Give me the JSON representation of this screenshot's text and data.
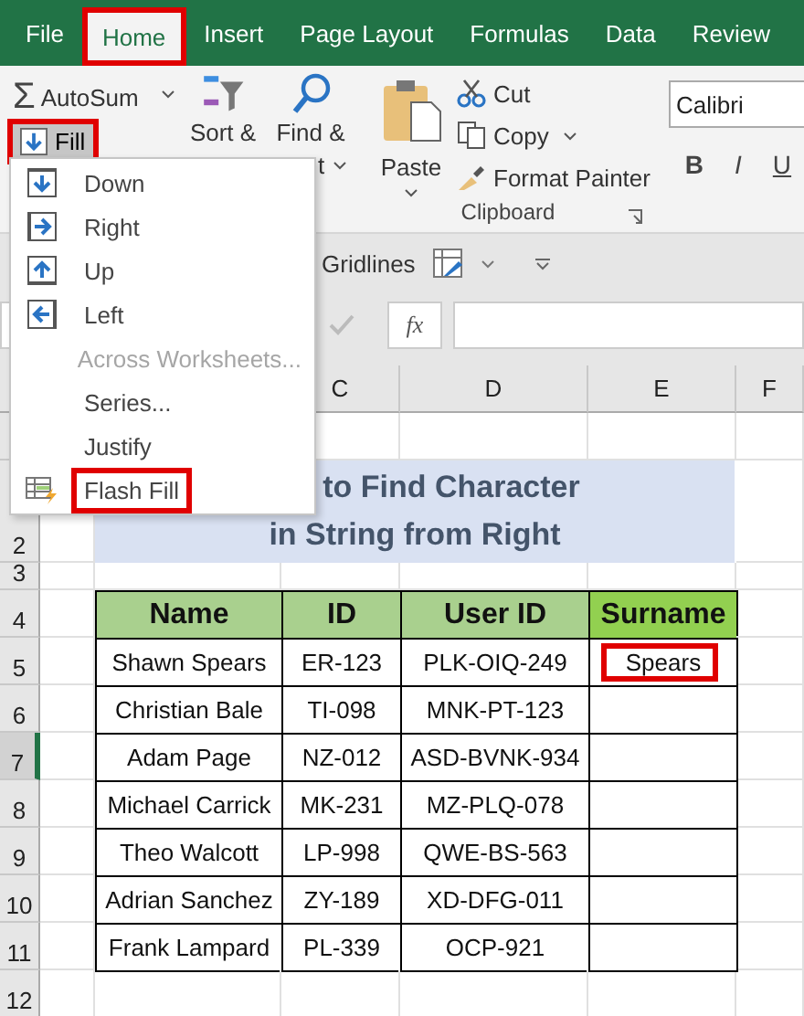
{
  "ribbon_tabs": [
    {
      "label": "File",
      "selected": false,
      "highlighted": false
    },
    {
      "label": "Home",
      "selected": true,
      "highlighted": true
    },
    {
      "label": "Insert",
      "selected": false,
      "highlighted": false
    },
    {
      "label": "Page Layout",
      "selected": false,
      "highlighted": false
    },
    {
      "label": "Formulas",
      "selected": false,
      "highlighted": false
    },
    {
      "label": "Data",
      "selected": false,
      "highlighted": false
    },
    {
      "label": "Review",
      "selected": false,
      "highlighted": false
    }
  ],
  "editing": {
    "autosum_symbol": "Σ",
    "autosum": "AutoSum",
    "fill": {
      "label": "Fill",
      "highlighted": true
    },
    "sort_label": "Sort &",
    "find_label": "Find &",
    "find_label_line2": "t"
  },
  "clipboard": {
    "paste": "Paste",
    "cut": "Cut",
    "copy": "Copy",
    "format_painter": "Format Painter",
    "group_label": "Clipboard"
  },
  "font": {
    "font_name": "Calibri",
    "bold": "B",
    "italic": "I",
    "underline": "U"
  },
  "view_bar": {
    "gridlines": "Gridlines"
  },
  "formula_bar": {
    "fx": "fx"
  },
  "fill_menu": [
    {
      "label": "Down",
      "kind": "down",
      "disabled": false,
      "highlighted": false
    },
    {
      "label": "Right",
      "kind": "right",
      "disabled": false,
      "highlighted": false
    },
    {
      "label": "Up",
      "kind": "up",
      "disabled": false,
      "highlighted": false
    },
    {
      "label": "Left",
      "kind": "left",
      "disabled": false,
      "highlighted": false
    },
    {
      "label": "Across Worksheets...",
      "kind": "plain",
      "disabled": true,
      "highlighted": false
    },
    {
      "label": "Series...",
      "kind": "plain",
      "disabled": false,
      "highlighted": false
    },
    {
      "label": "Justify",
      "kind": "plain",
      "disabled": false,
      "highlighted": false
    },
    {
      "label": "Flash Fill",
      "kind": "flash",
      "disabled": false,
      "highlighted": true
    }
  ],
  "columns": [
    "C",
    "D",
    "E",
    "F"
  ],
  "row_headers": [
    {
      "label": "2",
      "selected": false
    },
    {
      "label": "3",
      "selected": false
    },
    {
      "label": "4",
      "selected": false
    },
    {
      "label": "5",
      "selected": false
    },
    {
      "label": "6",
      "selected": false
    },
    {
      "label": "7",
      "selected": true
    },
    {
      "label": "8",
      "selected": false
    },
    {
      "label": "9",
      "selected": false
    },
    {
      "label": "10",
      "selected": false
    },
    {
      "label": "11",
      "selected": false
    },
    {
      "label": "12",
      "selected": false
    }
  ],
  "title": [
    "to Find Character",
    "in String from Right"
  ],
  "table": {
    "headers": [
      {
        "label": "Name",
        "color": "#a9d08e"
      },
      {
        "label": "ID",
        "color": "#a9d08e"
      },
      {
        "label": "User ID",
        "color": "#a9d08e"
      },
      {
        "label": "Surname",
        "color": "#92d050"
      }
    ],
    "rows": [
      {
        "name": "Shawn Spears",
        "id": "ER-123",
        "user_id": "PLK-OIQ-249",
        "surname": "Spears",
        "highlighted": true
      },
      {
        "name": "Christian Bale",
        "id": "TI-098",
        "user_id": "MNK-PT-123",
        "highlighted": false
      },
      {
        "name": "Adam Page",
        "id": "NZ-012",
        "user_id": "ASD-BVNK-934",
        "highlighted": false
      },
      {
        "name": "Michael Carrick",
        "id": "MK-231",
        "user_id": "MZ-PLQ-078",
        "highlighted": false
      },
      {
        "name": "Theo Walcott",
        "id": "LP-998",
        "user_id": "QWE-BS-563",
        "highlighted": false
      },
      {
        "name": "Adrian Sanchez",
        "id": "ZY-189",
        "user_id": "XD-DFG-011",
        "highlighted": false
      },
      {
        "name": "Frank Lampard",
        "id": "PL-339",
        "user_id": "OCP-921",
        "highlighted": false
      }
    ]
  }
}
